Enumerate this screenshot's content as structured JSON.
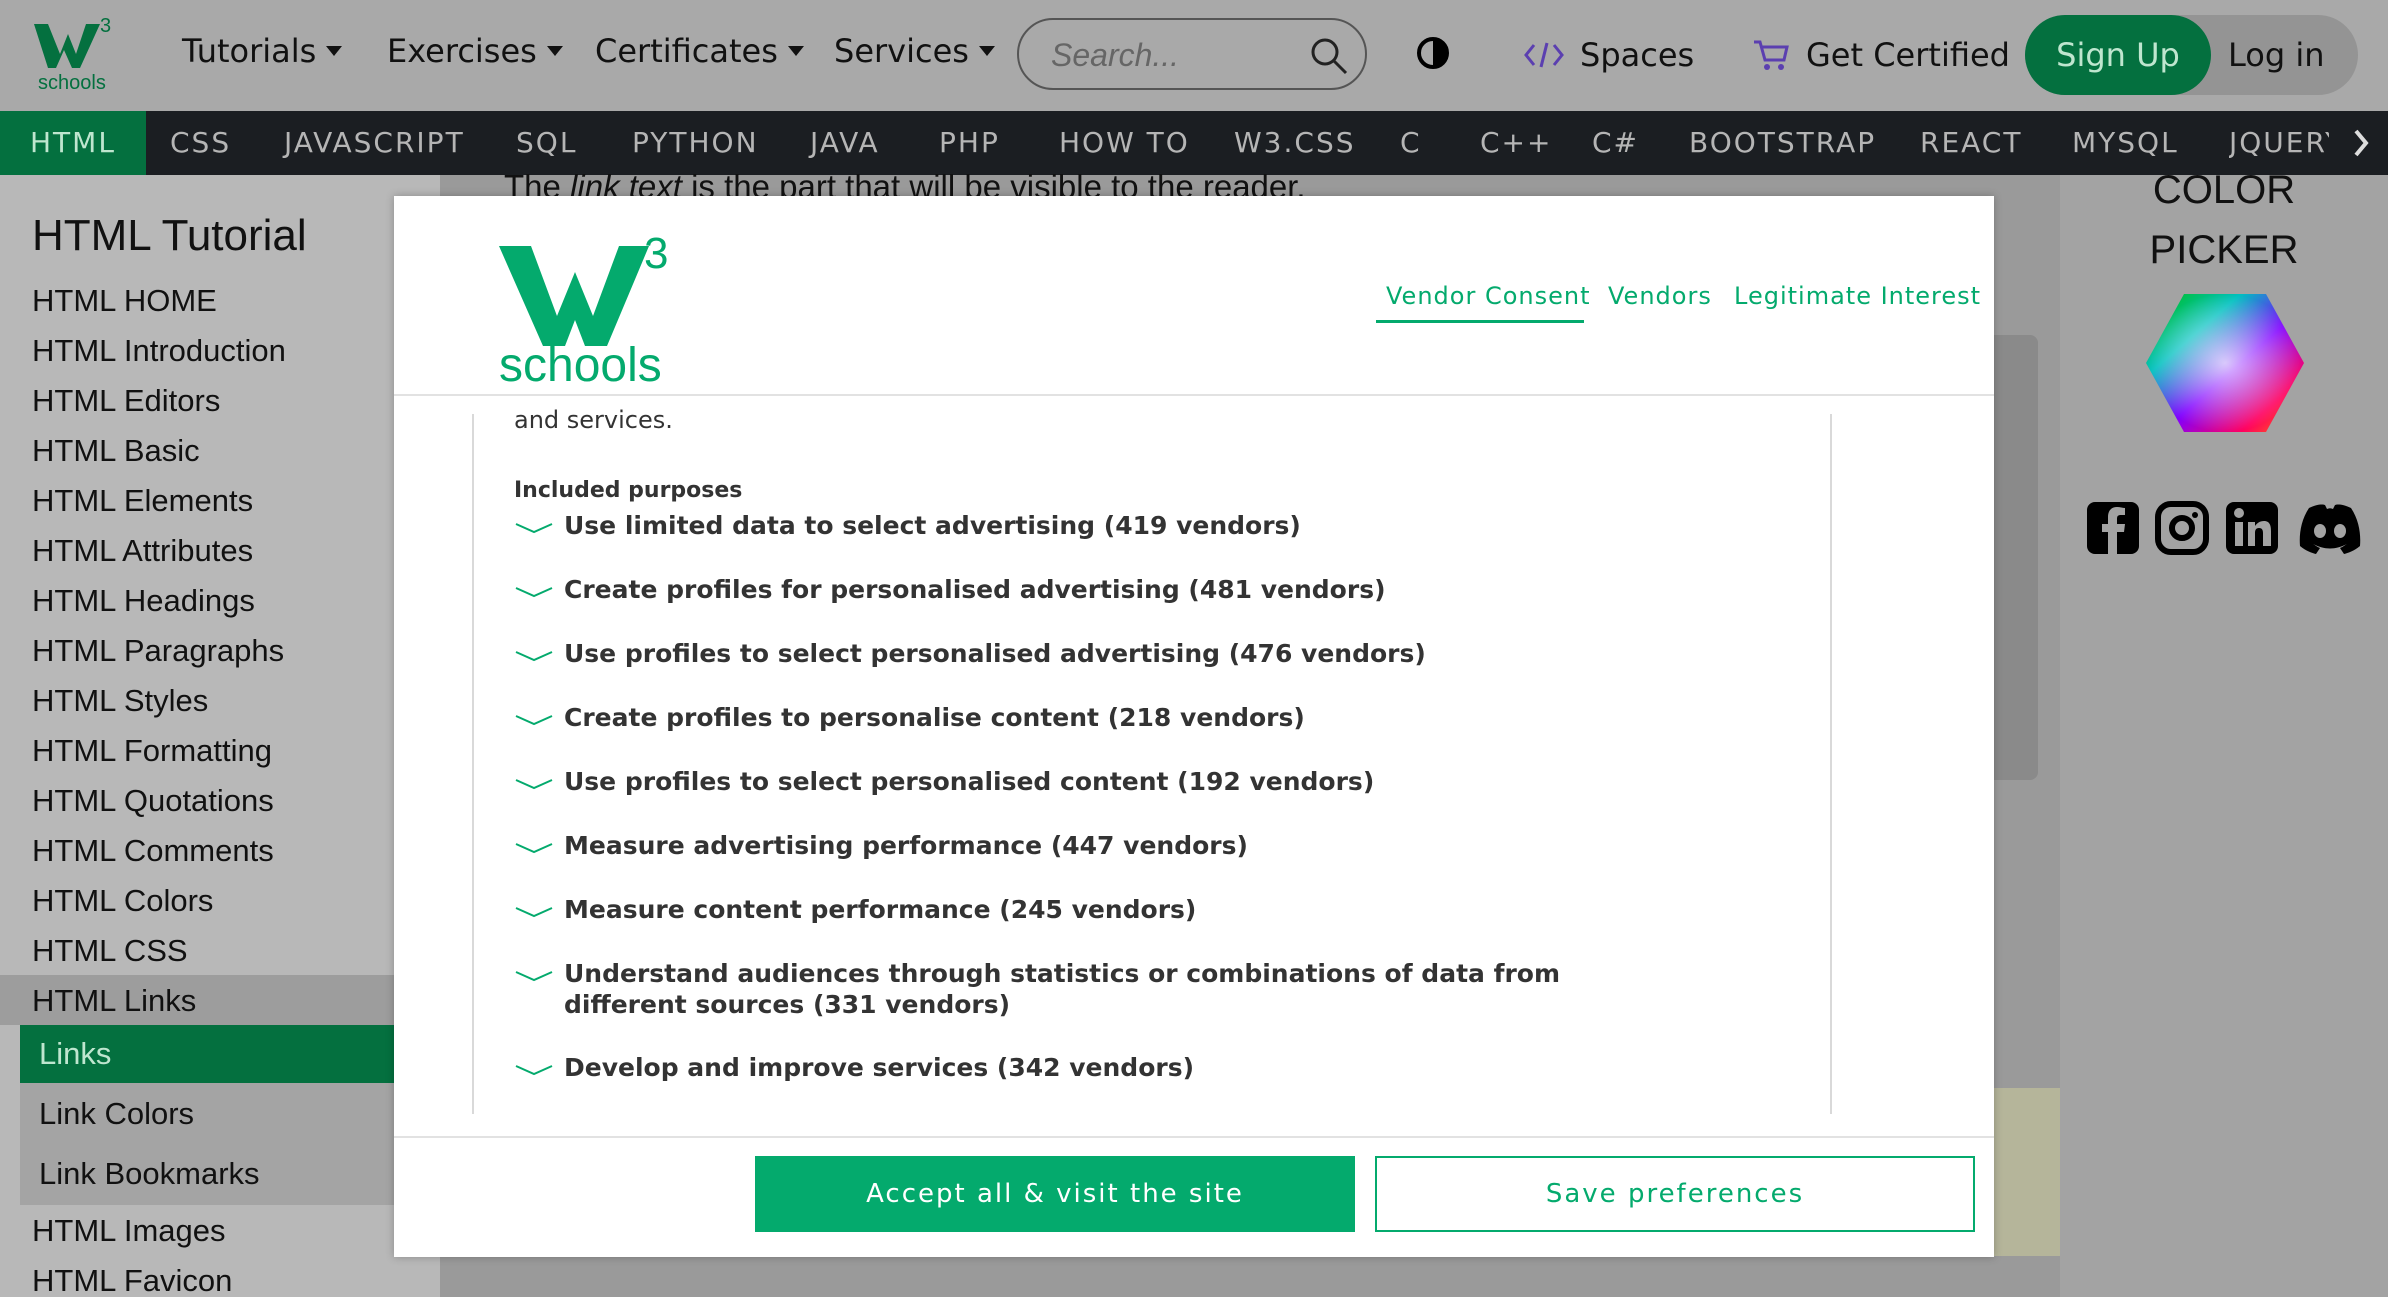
{
  "colors": {
    "brand_green": "#04aa6d",
    "dark_green": "#04703f",
    "subnav_bg": "#1b1e22"
  },
  "header": {
    "logo_text": "schools",
    "logo_sup": "3",
    "menus": [
      "Tutorials",
      "Exercises",
      "Certificates",
      "Services"
    ],
    "search_placeholder": "Search...",
    "spaces_label": "Spaces",
    "certified_label": "Get Certified",
    "signup_label": "Sign Up",
    "login_label": "Log in",
    "icons": [
      "search-icon",
      "contrast-icon",
      "code-icon",
      "cart-icon"
    ]
  },
  "subnav": {
    "items": [
      "HTML",
      "CSS",
      "JAVASCRIPT",
      "SQL",
      "PYTHON",
      "JAVA",
      "PHP",
      "HOW TO",
      "W3.CSS",
      "C",
      "C++",
      "C#",
      "BOOTSTRAP",
      "REACT",
      "MYSQL",
      "JQUERY"
    ]
  },
  "sidebar": {
    "title": "HTML Tutorial",
    "items": [
      "HTML HOME",
      "HTML Introduction",
      "HTML Editors",
      "HTML Basic",
      "HTML Elements",
      "HTML Attributes",
      "HTML Headings",
      "HTML Paragraphs",
      "HTML Styles",
      "HTML Formatting",
      "HTML Quotations",
      "HTML Comments",
      "HTML Colors",
      "HTML CSS",
      "HTML Links"
    ],
    "sub_items": [
      "Links",
      "Link Colors",
      "Link Bookmarks"
    ],
    "items_after": [
      "HTML Images",
      "HTML Favicon"
    ]
  },
  "background": {
    "text_before": "The ",
    "text_italic": "link text",
    "text_after": " is the part that will be visible to the reader.",
    "color_picker_line1": "COLOR",
    "color_picker_line2": "PICKER",
    "social_icons": [
      "facebook-icon",
      "instagram-icon",
      "linkedin-icon",
      "discord-icon"
    ]
  },
  "modal": {
    "logo_text": "schools",
    "logo_sup": "3",
    "tabs": [
      "Vendor Consent",
      "Vendors",
      "Legitimate Interest"
    ],
    "active_tab": "Vendor Consent",
    "cut_text": "and services.",
    "purposes_label": "Included purposes",
    "purposes": [
      "Use limited data to select advertising (419 vendors)",
      "Create profiles for personalised advertising (481 vendors)",
      "Use profiles to select personalised advertising (476 vendors)",
      "Create profiles to personalise content (218 vendors)",
      "Use profiles to select personalised content (192 vendors)",
      "Measure advertising performance (447 vendors)",
      "Measure content performance (245 vendors)",
      "Understand audiences through statistics or combinations of data from different sources (331 vendors)",
      "Develop and improve services (342 vendors)"
    ],
    "accept_label": "Accept all & visit the site",
    "save_label": "Save preferences"
  }
}
